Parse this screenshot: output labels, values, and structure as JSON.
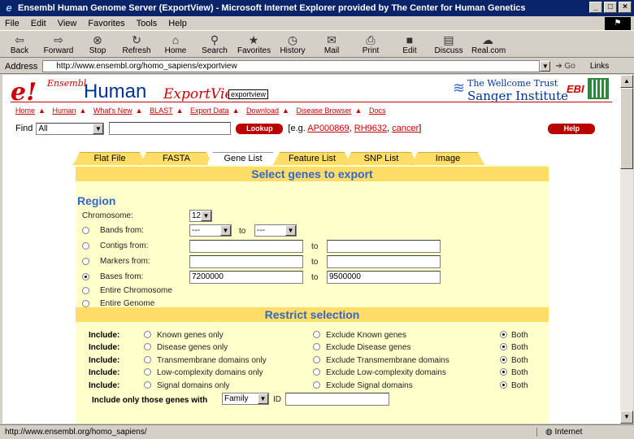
{
  "window": {
    "title": "Ensembl Human Genome Server (ExportView) - Microsoft Internet Explorer provided by The Center for Human Genetics",
    "min": "_",
    "max": "□",
    "close": "×"
  },
  "menu": [
    "File",
    "Edit",
    "View",
    "Favorites",
    "Tools",
    "Help"
  ],
  "toolbar": [
    "Back",
    "Forward",
    "Stop",
    "Refresh",
    "Home",
    "Search",
    "Favorites",
    "History",
    "Mail",
    "Print",
    "Edit",
    "Discuss",
    "Real.com"
  ],
  "address": {
    "label": "Address",
    "url": "http://www.ensembl.org/homo_sapiens/exportview",
    "go": "Go",
    "links": "Links"
  },
  "header": {
    "logo_e": "e!",
    "logo_ensembl": "Ensembl",
    "species": "Human",
    "view_name": "ExportView",
    "view_box": "exportview",
    "wellcome_line1": "The Wellcome Trust",
    "wellcome_line2": "Sanger Institute",
    "ebi": "EBI"
  },
  "nav": [
    "Home",
    "Human",
    "What's New",
    "BLAST",
    "Export Data",
    "Download",
    "Disease Browser",
    "Docs"
  ],
  "find": {
    "label": "Find",
    "scope": "All",
    "lookup": "Lookup",
    "eg_prefix": "[e.g.",
    "examples": [
      "AP000869",
      "RH9632",
      "cancer"
    ],
    "eg_suffix": "]",
    "help": "Help"
  },
  "tabs": [
    "Flat File",
    "FASTA",
    "Gene List",
    "Feature List",
    "SNP List",
    "Image"
  ],
  "active_tab": "Gene List",
  "panel": {
    "heading": "Select genes to export",
    "region_title": "Region",
    "chromosome_label": "Chromosome:",
    "chromosome_value": "12",
    "to_label": "to",
    "bands_label": "Bands from:",
    "bands_from": "---",
    "bands_to": "---",
    "contigs_label": "Contigs from:",
    "markers_label": "Markers from:",
    "bases_label": "Bases from:",
    "bases_from": "7200000",
    "bases_to": "9500000",
    "entire_chromosome": "Entire Chromosome",
    "entire_genome": "Entire Genome",
    "restrict_heading": "Restrict selection",
    "include_label": "Include:",
    "restrict_rows": [
      {
        "opt1": "Known genes only",
        "opt2": "Exclude Known genes",
        "opt3": "Both"
      },
      {
        "opt1": "Disease genes only",
        "opt2": "Exclude Disease genes",
        "opt3": "Both"
      },
      {
        "opt1": "Transmembrane domains only",
        "opt2": "Exclude Transmembrane domains",
        "opt3": "Both"
      },
      {
        "opt1": "Low-complexity domains only",
        "opt2": "Exclude Low-complexity domains",
        "opt3": "Both"
      },
      {
        "opt1": "Signal domains only",
        "opt2": "Exclude Signal domains",
        "opt3": "Both"
      }
    ],
    "include_only_label": "Include only those genes with",
    "family_value": "Family",
    "id_label": "ID"
  },
  "status": {
    "url": "http://www.ensembl.org/homo_sapiens/",
    "zone": "Internet"
  }
}
